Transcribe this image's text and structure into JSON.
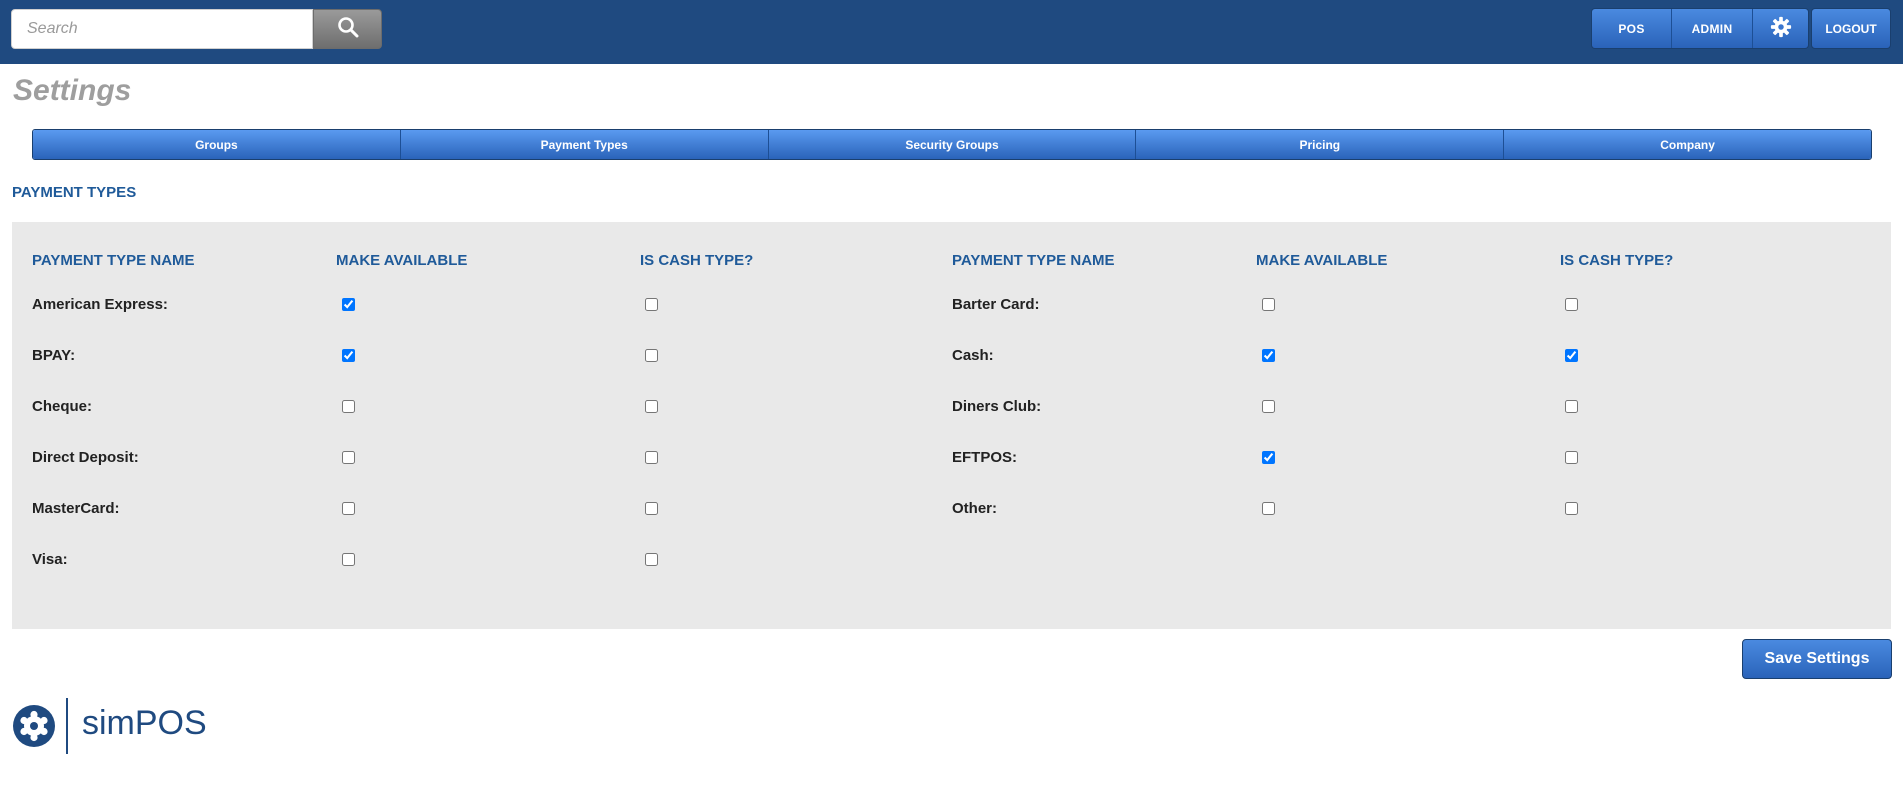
{
  "search": {
    "placeholder": "Search"
  },
  "header_nav": {
    "pos": "POS",
    "admin": "ADMIN",
    "logout": "LOGOUT"
  },
  "page": {
    "title": "Settings"
  },
  "tabs": [
    "Groups",
    "Payment Types",
    "Security Groups",
    "Pricing",
    "Company"
  ],
  "section": {
    "title": "PAYMENT TYPES"
  },
  "columns": {
    "name": "PAYMENT TYPE NAME",
    "available": "MAKE AVAILABLE",
    "cash": "IS CASH TYPE?"
  },
  "payment_types_left": [
    {
      "name": "American Express:",
      "available": true,
      "cash": false
    },
    {
      "name": "BPAY:",
      "available": true,
      "cash": false
    },
    {
      "name": "Cheque:",
      "available": false,
      "cash": false
    },
    {
      "name": "Direct Deposit:",
      "available": false,
      "cash": false
    },
    {
      "name": "MasterCard:",
      "available": false,
      "cash": false
    },
    {
      "name": "Visa:",
      "available": false,
      "cash": false
    }
  ],
  "payment_types_right": [
    {
      "name": "Barter Card:",
      "available": false,
      "cash": false
    },
    {
      "name": "Cash:",
      "available": true,
      "cash": true
    },
    {
      "name": "Diners Club:",
      "available": false,
      "cash": false
    },
    {
      "name": "EFTPOS:",
      "available": true,
      "cash": false
    },
    {
      "name": "Other:",
      "available": false,
      "cash": false
    }
  ],
  "save_label": "Save Settings",
  "brand": {
    "name": "simPOS"
  },
  "colors": {
    "header": "#1f4a80",
    "accent": "#1f5a99",
    "button": "#2a63b9",
    "panel": "#e9e9e9"
  }
}
